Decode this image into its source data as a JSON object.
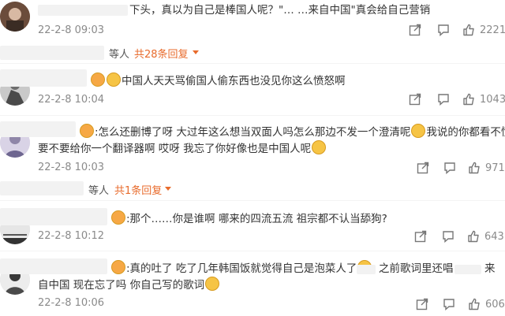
{
  "comments": [
    {
      "text": "下头，真以为自己是棒国人呢？\"…  …来自中国\"真会给自己营销",
      "time": "22-2-8 09:03",
      "likes": "2221"
    },
    {
      "text": "中国人天天骂偷国人偷东西也没见你这么愤怒啊",
      "time": "22-2-8 10:04",
      "likes": "1043"
    },
    {
      "text_line1": ":怎么还删博了呀 大过年这么想当双面人吗怎么那边不发一个澄清呢",
      "text_line1b": "我说的你都看不懂?",
      "text_line2": "要不要给你一个翻译器啊 哎呀 我忘了你好像也是中国人呢",
      "time": "22-2-8 10:03",
      "likes": "971"
    },
    {
      "text": ":那个……你是谁啊 哪来的四流五流 祖宗都不认当舔狗?",
      "time": "22-2-8 10:12",
      "likes": "643"
    },
    {
      "text_line1": ":真的吐了 吃了几年韩国饭就觉得自己是泡菜人了",
      "text_line1b": "之前歌词里还唱",
      "text_line1c": "来",
      "text_line2": "自中国 现在忘了吗 你自己写的歌词",
      "time": "22-2-8 10:06",
      "likes": "606"
    }
  ],
  "reply_rows": [
    {
      "prefix": "等人",
      "count": "共28条回复"
    },
    {
      "prefix": "等人",
      "count": "共1条回复"
    }
  ],
  "icons": [
    "share-icon",
    "comment-icon",
    "like-icon",
    "dropdown-arrow-icon"
  ]
}
